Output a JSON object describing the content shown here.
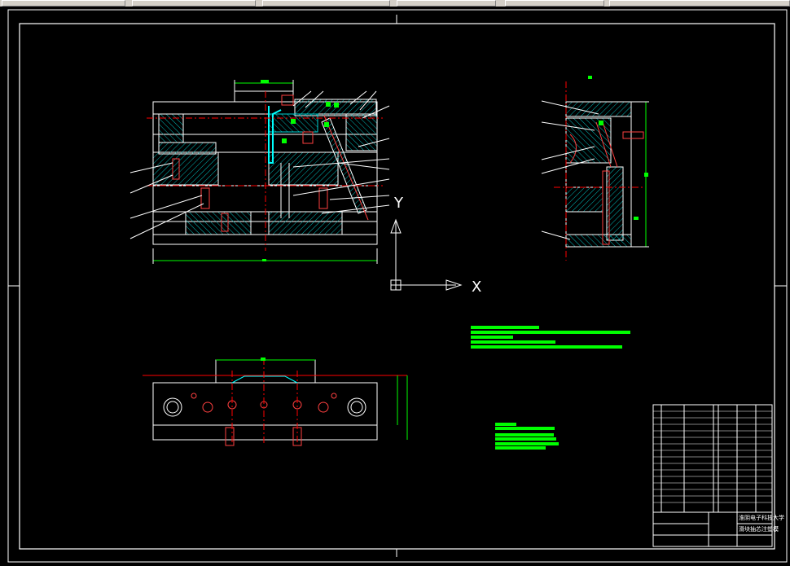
{
  "app": {
    "toolbar": {
      "segments": [
        "toolbar-segment-1",
        "toolbar-segment-2",
        "toolbar-segment-3",
        "toolbar-segment-4",
        "toolbar-segment-5",
        "toolbar-segment-6"
      ]
    }
  },
  "ucs": {
    "x_label": "X",
    "y_label": "Y"
  },
  "title_block": {
    "line1": "淮阴电子科技大学",
    "line2": "滑块抽芯注塑模"
  },
  "colors": {
    "background": "#000000",
    "line": "#ffffff",
    "hatch": "#00c8c8",
    "dim": "#00ff00",
    "center": "#ff0000",
    "part": "#ff4040"
  }
}
